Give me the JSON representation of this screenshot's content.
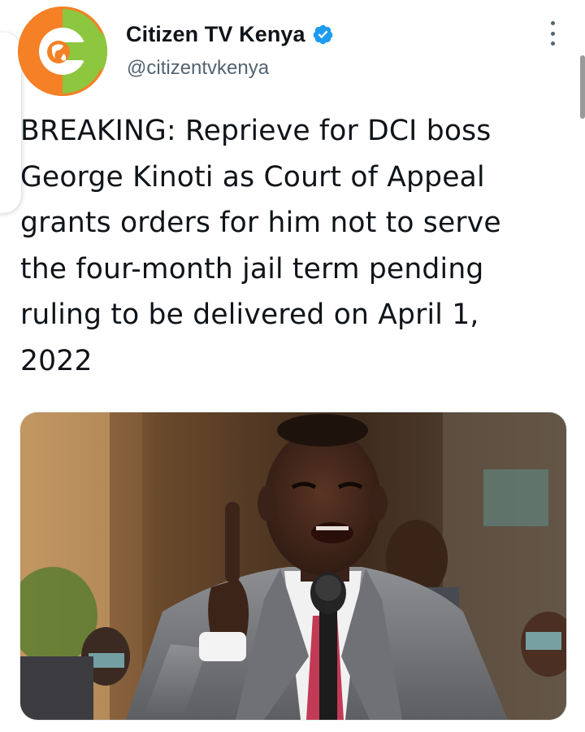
{
  "account": {
    "display_name": "Citizen TV Kenya",
    "handle": "@citizentvkenya",
    "verified": true
  },
  "tweet": {
    "lines": [
      "BREAKING: Reprieve for DCI boss",
      "George Kinoti as Court of Appeal",
      "grants orders for him not to serve",
      "the four-month jail term pending",
      "ruling to be delivered on April 1,",
      "2022"
    ]
  },
  "icons": {
    "avatar": "citizen-tv-logo",
    "verified": "verified-badge-icon",
    "more": "more-options-icon"
  },
  "colors": {
    "verified_blue": "#1d9bf0",
    "text": "#0f1419",
    "secondary": "#536471",
    "logo_orange": "#f58025",
    "logo_green": "#8dc63f"
  }
}
